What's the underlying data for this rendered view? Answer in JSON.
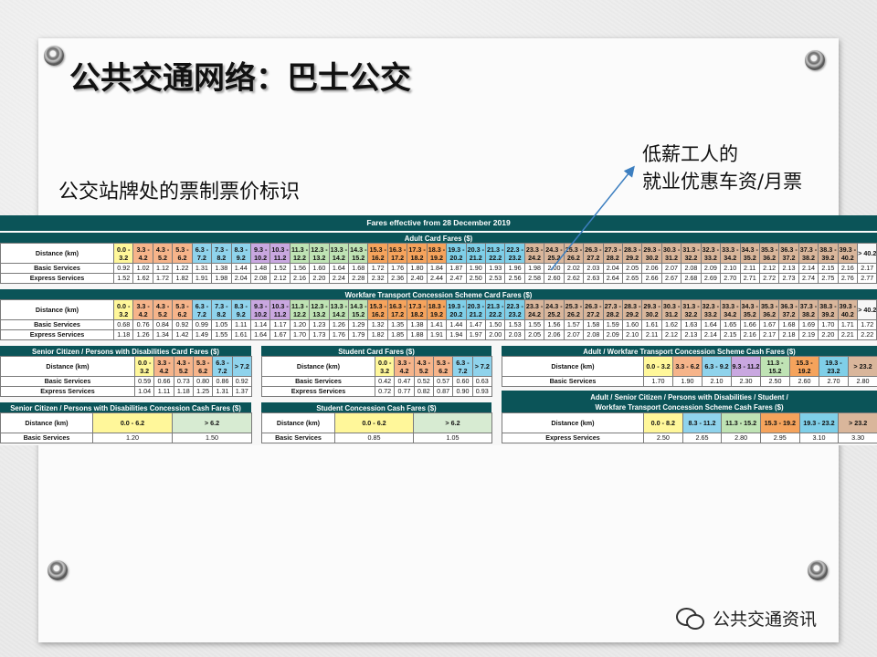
{
  "slide": {
    "title": "公共交通网络：巴士公交",
    "subtitle": "公交站牌处的票制票价标识",
    "callout_line1": "低薪工人的",
    "callout_line2": "就业优惠车资/月票",
    "watermark": "公共交通资讯"
  },
  "fares": {
    "main_title": "Fares effective from 28 December 2019",
    "row_labels": {
      "distance": "Distance (km)",
      "basic": "Basic Services",
      "express": "Express Services"
    },
    "distance_bands": [
      "0.0 - 3.2",
      "3.3 - 4.2",
      "4.3 - 5.2",
      "5.3 - 6.2",
      "6.3 - 7.2",
      "7.3 - 8.2",
      "8.3 - 9.2",
      "9.3 - 10.2",
      "10.3 - 11.2",
      "11.3 - 12.2",
      "12.3 - 13.2",
      "13.3 - 14.2",
      "14.3 - 15.2",
      "15.3 - 16.2",
      "16.3 - 17.2",
      "17.3 - 18.2",
      "18.3 - 19.2",
      "19.3 - 20.2",
      "20.3 - 21.2",
      "21.3 - 22.2",
      "22.3 - 23.2",
      "23.3 - 24.2",
      "24.3 - 25.2",
      "25.3 - 26.2",
      "26.3 - 27.2",
      "27.3 - 28.2",
      "28.3 - 29.2",
      "29.3 - 30.2",
      "30.3 - 31.2",
      "31.3 - 32.2",
      "32.3 - 33.2",
      "33.3 - 34.2",
      "34.3 - 35.2",
      "35.3 - 36.2",
      "36.3 - 37.2",
      "37.3 - 38.2",
      "38.3 - 39.2",
      "39.3 - 40.2",
      "> 40.2"
    ],
    "adult_card": {
      "title": "Adult Card Fares ($)",
      "basic": [
        "0.92",
        "1.02",
        "1.12",
        "1.22",
        "1.31",
        "1.38",
        "1.44",
        "1.48",
        "1.52",
        "1.56",
        "1.60",
        "1.64",
        "1.68",
        "1.72",
        "1.76",
        "1.80",
        "1.84",
        "1.87",
        "1.90",
        "1.93",
        "1.96",
        "1.98",
        "2.00",
        "2.02",
        "2.03",
        "2.04",
        "2.05",
        "2.06",
        "2.07",
        "2.08",
        "2.09",
        "2.10",
        "2.11",
        "2.12",
        "2.13",
        "2.14",
        "2.15",
        "2.16",
        "2.17"
      ],
      "express": [
        "1.52",
        "1.62",
        "1.72",
        "1.82",
        "1.91",
        "1.98",
        "2.04",
        "2.08",
        "2.12",
        "2.16",
        "2.20",
        "2.24",
        "2.28",
        "2.32",
        "2.36",
        "2.40",
        "2.44",
        "2.47",
        "2.50",
        "2.53",
        "2.56",
        "2.58",
        "2.60",
        "2.62",
        "2.63",
        "2.64",
        "2.65",
        "2.66",
        "2.67",
        "2.68",
        "2.69",
        "2.70",
        "2.71",
        "2.72",
        "2.73",
        "2.74",
        "2.75",
        "2.76",
        "2.77"
      ]
    },
    "workfare_card": {
      "title": "Workfare Transport Concession Scheme Card Fares ($)",
      "basic": [
        "0.68",
        "0.76",
        "0.84",
        "0.92",
        "0.99",
        "1.05",
        "1.11",
        "1.14",
        "1.17",
        "1.20",
        "1.23",
        "1.26",
        "1.29",
        "1.32",
        "1.35",
        "1.38",
        "1.41",
        "1.44",
        "1.47",
        "1.50",
        "1.53",
        "1.55",
        "1.56",
        "1.57",
        "1.58",
        "1.59",
        "1.60",
        "1.61",
        "1.62",
        "1.63",
        "1.64",
        "1.65",
        "1.66",
        "1.67",
        "1.68",
        "1.69",
        "1.70",
        "1.71",
        "1.72"
      ],
      "express": [
        "1.18",
        "1.26",
        "1.34",
        "1.42",
        "1.49",
        "1.55",
        "1.61",
        "1.64",
        "1.67",
        "1.70",
        "1.73",
        "1.76",
        "1.79",
        "1.82",
        "1.85",
        "1.88",
        "1.91",
        "1.94",
        "1.97",
        "2.00",
        "2.03",
        "2.05",
        "2.06",
        "2.07",
        "2.08",
        "2.09",
        "2.10",
        "2.11",
        "2.12",
        "2.13",
        "2.14",
        "2.15",
        "2.16",
        "2.17",
        "2.18",
        "2.19",
        "2.20",
        "2.21",
        "2.22"
      ]
    },
    "senior_card": {
      "title": "Senior Citizen / Persons with Disabilities Card Fares ($)",
      "bands": [
        "0.0 - 3.2",
        "3.3 - 4.2",
        "4.3 - 5.2",
        "5.3 - 6.2",
        "6.3 - 7.2",
        "> 7.2"
      ],
      "basic": [
        "0.59",
        "0.66",
        "0.73",
        "0.80",
        "0.86",
        "0.92"
      ],
      "express": [
        "1.04",
        "1.11",
        "1.18",
        "1.25",
        "1.31",
        "1.37"
      ]
    },
    "student_card": {
      "title": "Student Card Fares ($)",
      "bands": [
        "0.0 - 3.2",
        "3.3 - 4.2",
        "4.3 - 5.2",
        "5.3 - 6.2",
        "6.3 - 7.2",
        "> 7.2"
      ],
      "basic": [
        "0.42",
        "0.47",
        "0.52",
        "0.57",
        "0.60",
        "0.63"
      ],
      "express": [
        "0.72",
        "0.77",
        "0.82",
        "0.87",
        "0.90",
        "0.93"
      ]
    },
    "adult_workfare_cash": {
      "title": "Adult / Workfare Transport Concession Scheme Cash Fares ($)",
      "bands": [
        "0.0 - 3.2",
        "3.3 - 6.2",
        "6.3 - 9.2",
        "9.3 - 11.2",
        "11.3 - 15.2",
        "15.3 - 19.2",
        "19.3 - 23.2",
        "> 23.2"
      ],
      "basic": [
        "1.70",
        "1.90",
        "2.10",
        "2.30",
        "2.50",
        "2.60",
        "2.70",
        "2.80"
      ]
    },
    "adult_senior_student_cash": {
      "title_line1": "Adult / Senior Citizen / Persons with Disabilities / Student /",
      "title_line2": "Workfare Transport Concession Scheme Cash Fares ($)",
      "bands": [
        "0.0 - 8.2",
        "8.3 - 11.2",
        "11.3 - 15.2",
        "15.3 - 19.2",
        "19.3 - 23.2",
        "> 23.2"
      ],
      "express": [
        "2.50",
        "2.65",
        "2.80",
        "2.95",
        "3.10",
        "3.30"
      ]
    },
    "senior_cash": {
      "title": "Senior Citizen / Persons with Disabilities Concession Cash Fares ($)",
      "bands": [
        "0.0 - 6.2",
        "> 6.2"
      ],
      "basic": [
        "1.20",
        "1.50"
      ]
    },
    "student_cash": {
      "title": "Student Concession Cash Fares ($)",
      "bands": [
        "0.0 - 6.2",
        "> 6.2"
      ],
      "basic": [
        "0.85",
        "1.05"
      ]
    }
  },
  "colors": {
    "header_teal": "#0b5458",
    "band_yellow": "#fff79a",
    "band_orange": "#f6b48a",
    "band_blue": "#8fd3ec",
    "band_purple": "#c9a7e0",
    "band_green": "#bfe3b4",
    "band_red_orange": "#f5a35c",
    "band_cyan": "#7fcfe8",
    "band_tan": "#d9b69b"
  }
}
